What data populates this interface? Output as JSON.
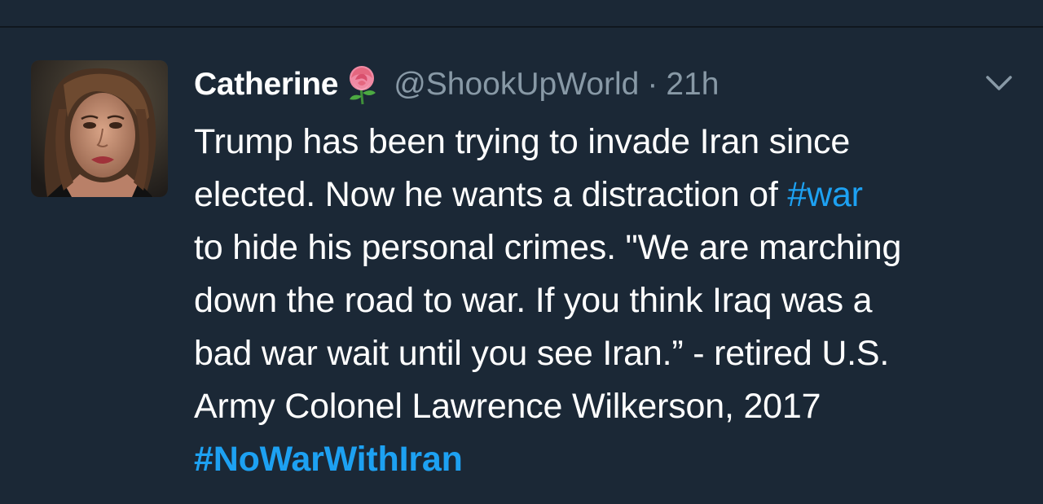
{
  "tweet": {
    "display_name": "Catherine",
    "name_emoji": "rose",
    "handle": "@ShookUpWorld",
    "separator": "·",
    "time": "21h",
    "body_lines": {
      "l1": "Trump has been trying to invade Iran since",
      "l2a": "elected. Now he wants a distraction of ",
      "l2b": "#war",
      "l3": "to hide his personal crimes. \"We are marching",
      "l4": "down the road to war. If you think Iraq was a",
      "l5": "bad war wait until you see Iran.” - retired U.S.",
      "l6": "Army Colonel Lawrence Wilkerson, 2017",
      "l7": "#NoWarWithIran"
    }
  },
  "icons": {
    "avatar": "profile-photo",
    "menu": "chevron-down-icon",
    "emoji": "rose-icon"
  },
  "colors": {
    "background": "#1b2836",
    "link": "#1da1f2",
    "muted": "#8899a6",
    "text": "#ffffff"
  }
}
